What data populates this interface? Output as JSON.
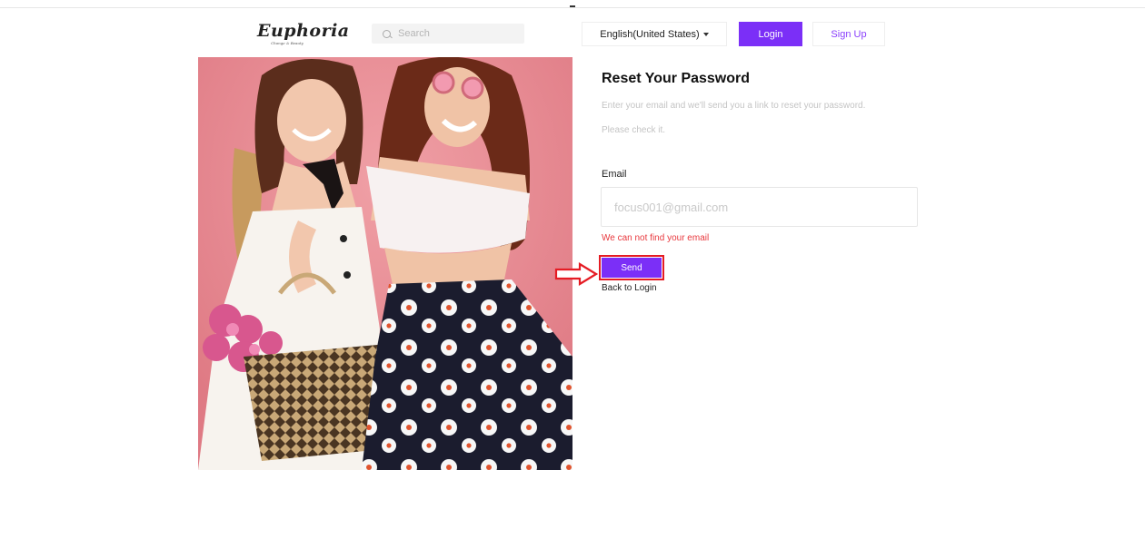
{
  "header": {
    "logo_text": "Euphoria",
    "logo_tagline": "Change & Beauty",
    "search_placeholder": "Search",
    "language": "English(United States)",
    "login_label": "Login",
    "signup_label": "Sign Up"
  },
  "reset": {
    "title": "Reset Your Password",
    "description_line1": "Enter your email and we'll send you a link to reset your password.",
    "description_line2": "Please check it.",
    "email_label": "Email",
    "email_value": "focus001@gmail.com",
    "error_text": "We can not find your email",
    "send_label": "Send",
    "back_label": "Back to Login"
  },
  "colors": {
    "accent": "#7b2ff7",
    "error": "#e8383d",
    "highlight": "#e51c24",
    "hero_background": "#e8878f"
  },
  "icons": [
    "search-icon",
    "caret-down-icon",
    "arrow-right-icon"
  ]
}
